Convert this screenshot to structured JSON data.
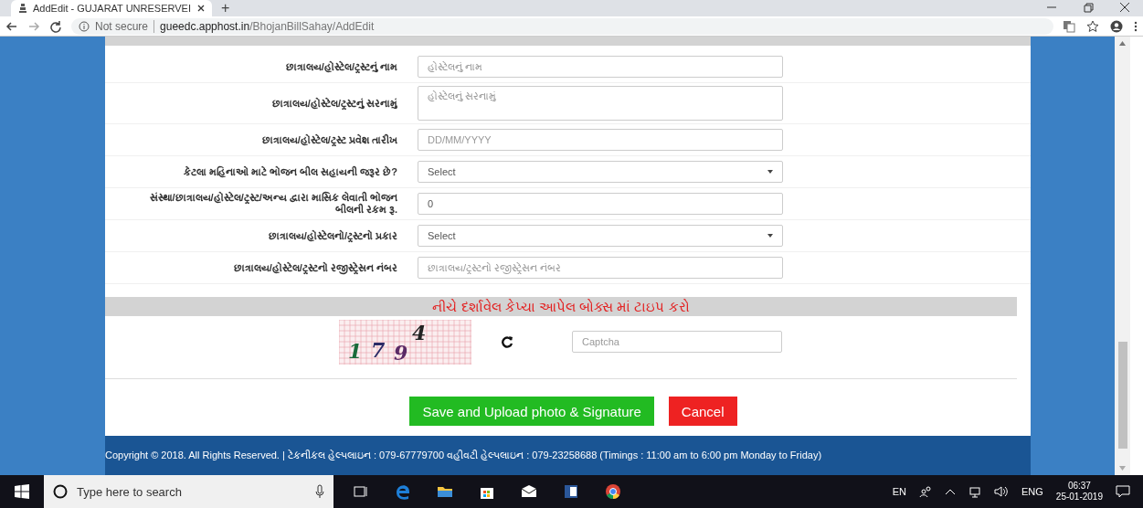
{
  "browser": {
    "tab_title": "AddEdit - GUJARAT UNRESERVEI",
    "new_tab": "+",
    "security": "Not secure",
    "url_host": "gueedc.apphost.in",
    "url_path": "/BhojanBillSahay/AddEdit"
  },
  "form": {
    "rows": [
      {
        "kind": "input",
        "label": "છાત્રાલય/હોસ્ટેલ/ટ્રસ્ટનું નામ",
        "placeholder": "હોસ્ટેલનું નામ"
      },
      {
        "kind": "textarea",
        "label": "છાત્રાલય/હોસ્ટેલ/ટ્રસ્ટનું સરનામું",
        "placeholder": "હોસ્ટેલનું સરનામું"
      },
      {
        "kind": "input",
        "label": "છાત્રાલય/હોસ્ટેલ/ટ્રસ્ટ પ્રવેશ તારીખ",
        "placeholder": "DD/MM/YYYY"
      },
      {
        "kind": "select",
        "label": "કેટલા મહિનાઓ માટે ભોજન બીલ સહાયની જરૂર છે?",
        "value": "Select"
      },
      {
        "kind": "input",
        "label": "સંસ્થા/છાત્રાલય/હોસ્ટેલ/ટ્રસ્ટ/અન્ય દ્વારા માસિક લેવાતી ભોજન બીલની રકમ રૂ.",
        "value": "0"
      },
      {
        "kind": "select",
        "label": "છાત્રાલય/હોસ્ટેલનો/ટ્રસ્ટનો પ્રકાર",
        "value": "Select"
      },
      {
        "kind": "input",
        "label": "છાત્રાલય/હોસ્ટેલ/ટ્રસ્ટનો રજીસ્ટ્રેસન નંબર",
        "placeholder": "છાત્રાલય/ટ્રસ્ટનો રજીસ્ટ્રેસન નંબર"
      }
    ]
  },
  "captcha": {
    "heading": "નીચે દર્શાવેલ કેપ્ચા આપેલ બોક્સ માં ટાઇપ કરો",
    "characters": [
      "1",
      "7",
      "9",
      "4"
    ],
    "placeholder": "Captcha"
  },
  "buttons": [
    {
      "kind": "save",
      "label": "Save and Upload photo & Signature"
    },
    {
      "kind": "cancel",
      "label": "Cancel"
    }
  ],
  "footer": "Copyright © 2018. All Rights Reserved.  | ટેકનીકલ હેલ્પલાઇન : 079-67779700 વહીવટી હેલ્પલાઇન : 079-23258688 (Timings : 11:00 am to 6:00 pm Monday to Friday)",
  "taskbar": {
    "search_placeholder": "Type here to search",
    "language_short": "EN",
    "language": "ENG",
    "time": "06:37",
    "date": "25-01-2019"
  }
}
